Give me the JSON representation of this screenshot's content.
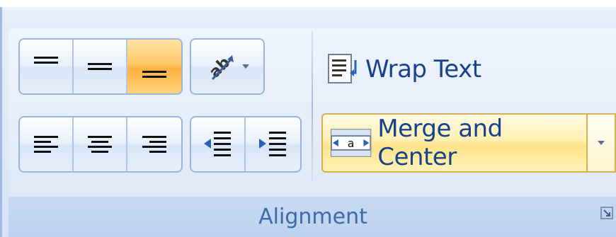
{
  "group": {
    "title": "Alignment"
  },
  "vertical_align": {
    "items": [
      {
        "name": "top-align",
        "active": false
      },
      {
        "name": "middle-align",
        "active": false
      },
      {
        "name": "bottom-align",
        "active": true
      }
    ]
  },
  "orientation": {
    "icon": "text-orientation-icon"
  },
  "horizontal_align": {
    "items": [
      {
        "name": "align-left"
      },
      {
        "name": "center"
      },
      {
        "name": "align-right"
      }
    ]
  },
  "indent": {
    "items": [
      {
        "name": "decrease-indent"
      },
      {
        "name": "increase-indent"
      }
    ]
  },
  "wrap_text": {
    "label": "Wrap Text"
  },
  "merge_center": {
    "label": "Merge and Center",
    "icon_text": "a"
  },
  "colors": {
    "label_blue": "#15428b",
    "active_orange": "#ffb040",
    "hover_yellow": "#ffe388"
  }
}
